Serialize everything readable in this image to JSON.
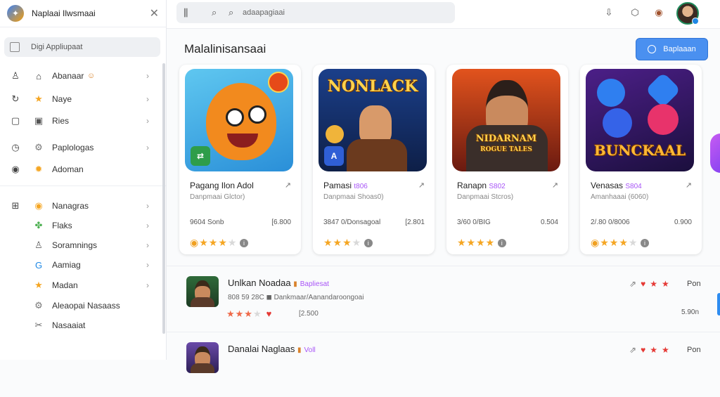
{
  "app": {
    "title": "Naplaai Ilwsmaai"
  },
  "sidebar": {
    "search_label": "Digi Appliupaat",
    "items": [
      {
        "label": "Abanaar",
        "left_icon": "user-icon",
        "color_icon": "home-icon",
        "color_glyph": "⌂",
        "extra": "☺",
        "chevron": true
      },
      {
        "label": "Naye",
        "left_icon": "refresh-icon",
        "color_icon": "star-icon",
        "color_glyph": "★",
        "chevron": true
      },
      {
        "label": "Ries",
        "left_icon": "square-icon",
        "color_icon": "image-icon",
        "color_glyph": "▣",
        "chevron": true
      },
      {
        "label": "Paplologas",
        "left_icon": "clock-icon",
        "color_icon": "settings-icon",
        "color_glyph": "⚙",
        "chevron": true
      },
      {
        "label": "Adoman",
        "left_icon": "eye-icon",
        "color_icon": "star-icon",
        "color_glyph": "✹",
        "chevron": false
      },
      {
        "label": "Nanagras",
        "left_icon": "grid-icon",
        "color_icon": "coin-icon",
        "color_glyph": "◉",
        "chevron": true
      },
      {
        "label": "Flaks",
        "left_icon": "",
        "color_icon": "puzzle-icon",
        "color_glyph": "✤",
        "chevron": true
      },
      {
        "label": "Soramnings",
        "left_icon": "",
        "color_icon": "person-icon",
        "color_glyph": "♙",
        "chevron": true
      },
      {
        "label": "Aamiag",
        "left_icon": "",
        "color_icon": "google-icon",
        "color_glyph": "G",
        "chevron": true
      },
      {
        "label": "Madan",
        "left_icon": "",
        "color_icon": "star-icon",
        "color_glyph": "★",
        "chevron": true
      },
      {
        "label": "Aleaopai Nasaass",
        "left_icon": "",
        "color_icon": "gear-icon",
        "color_glyph": "⚙",
        "chevron": false
      },
      {
        "label": "Nasaaiat",
        "left_icon": "",
        "color_icon": "tools-icon",
        "color_glyph": "✂",
        "chevron": false
      }
    ]
  },
  "topbar": {
    "search_placeholder": "adaapagiaai",
    "icons": [
      "filter-icon",
      "search-icon",
      "download-icon",
      "shield-icon",
      "badge-icon"
    ]
  },
  "section": {
    "title": "Malalinisansaai",
    "button_label": "Baplaaan"
  },
  "cards": [
    {
      "name": "Pagang Ilon Adol",
      "tag": "",
      "sub": "Danpmaai Glctor)",
      "meta_left": "9604 Sonb",
      "meta_right": "[6.800",
      "rating": 3,
      "theme": "fox"
    },
    {
      "name": "Pamasi",
      "tag": "t806",
      "sub": "Danpmaai Shoas0)",
      "meta_left": "3847 0/Donsagoal",
      "meta_right": "[2.801",
      "rating": 3,
      "theme": "warrior"
    },
    {
      "name": "Ranapn",
      "tag": "S802",
      "sub": "Danpmaai Stcros)",
      "meta_left": "3/60 0/BIG",
      "meta_right": "0.504",
      "rating": 4,
      "theme": "hero"
    },
    {
      "name": "Venasas",
      "tag": "S804",
      "sub": "Amanhaaai (6060)",
      "meta_left": "2/.80 0/8006",
      "meta_right": "0.900",
      "rating": 3,
      "theme": "bubbles"
    }
  ],
  "rows": [
    {
      "name": "Unlkan Noadaa",
      "tag": "Bapliesat",
      "sub": "808 59 28C ◼ Dankmaar/Aanandaroongoai",
      "rating": 3,
      "size": "[2.500",
      "action_label": "Pon",
      "right_value": "5.90n"
    },
    {
      "name": "Danalai Naglaas",
      "tag": "Voll",
      "sub": "",
      "rating": 3,
      "size": "",
      "action_label": "Pon",
      "right_value": ""
    }
  ],
  "colors": {
    "accent": "#4a90f0",
    "tag": "#a855f7",
    "star": "#f5a623",
    "heart": "#e53935"
  }
}
